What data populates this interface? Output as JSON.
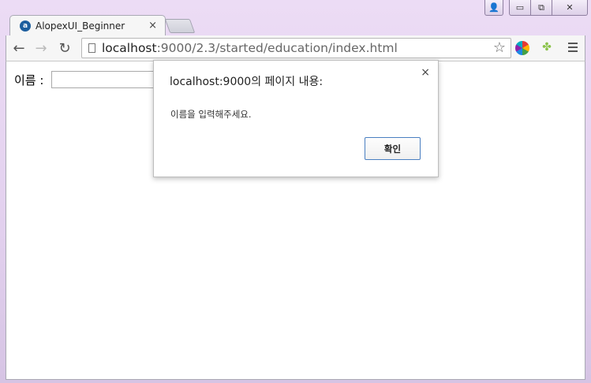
{
  "window": {
    "controls": {
      "user": "👤",
      "minimize": "▭",
      "maximize": "⧉",
      "close": "✕"
    }
  },
  "tabs": [
    {
      "title": "AlopexUI_Beginner",
      "close": "×",
      "favicon": "alopex-favicon"
    }
  ],
  "toolbar": {
    "back": "←",
    "forward": "→",
    "reload": "↻",
    "url_host": "localhost",
    "url_rest": ":9000/2.3/started/education/index.html",
    "bookmark_star": "☆",
    "extensions": [
      "color-wheel-icon",
      "android-icon"
    ],
    "android_glyph": "✤"
  },
  "page": {
    "name_label": "이름 :",
    "name_value": ""
  },
  "dialog": {
    "title": "localhost:9000의 페이지 내용:",
    "close": "×",
    "message": "이름을 입력해주세요.",
    "ok_label": "확인",
    "accent_color": "#4a7fc1"
  }
}
